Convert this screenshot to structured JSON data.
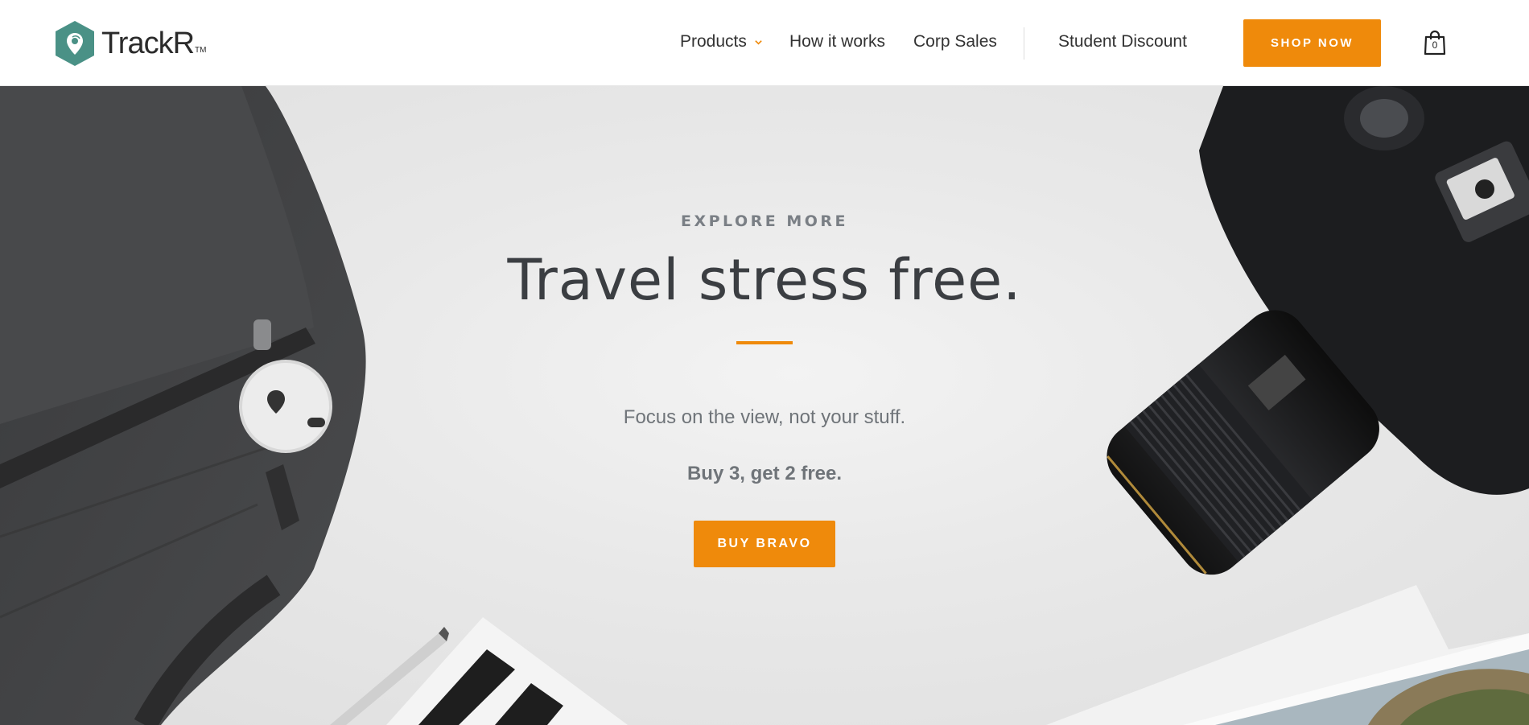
{
  "brand": {
    "name": "TrackR",
    "tm": "TM",
    "color": "#4a9186"
  },
  "nav": {
    "products": "Products",
    "how_it_works": "How it works",
    "corp_sales": "Corp Sales",
    "student_discount": "Student Discount",
    "shop_now": "SHOP NOW",
    "cart_count": "0"
  },
  "hero": {
    "eyebrow": "EXPLORE MORE",
    "headline": "Travel stress free.",
    "subtext": "Focus on the view, not your stuff.",
    "offer": "Buy 3, get 2 free.",
    "cta": "BUY BRAVO"
  },
  "colors": {
    "accent": "#ef8a0b",
    "text_dark": "#3b3e42",
    "text_muted": "#6f7479"
  },
  "icons": [
    "trackr-logo-icon",
    "chevron-down-icon",
    "shopping-bag-icon"
  ]
}
